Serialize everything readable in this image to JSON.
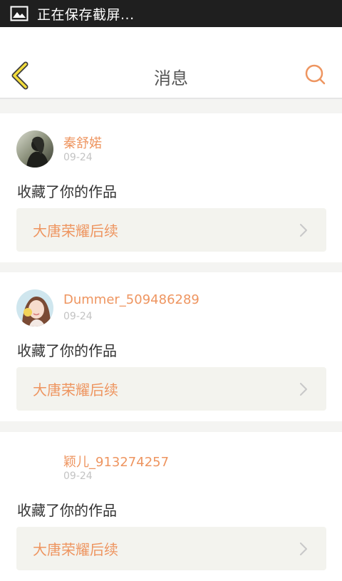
{
  "status_bar": {
    "icon": "image-icon",
    "text": "正在保存截屏..."
  },
  "header": {
    "title": "消息",
    "back_icon": "chevron-left-icon",
    "search_icon": "search-icon"
  },
  "colors": {
    "accent": "#ee9560",
    "back_icon": "#f3dc3c",
    "card_bg": "#ffffff",
    "page_bg": "#f4f4f2",
    "link_bg": "#f3f3ee"
  },
  "notifications": [
    {
      "username": "秦舒婼",
      "date": "09-24",
      "message": "收藏了你的作品",
      "work_title": "大唐荣耀后续",
      "avatar": "avatar-photo"
    },
    {
      "username": "Dummer_509486289",
      "date": "09-24",
      "message": "收藏了你的作品",
      "work_title": "大唐荣耀后续",
      "avatar": "avatar-photo"
    },
    {
      "username": "颖儿_913274257",
      "date": "09-24",
      "message": "收藏了你的作品",
      "work_title": "大唐荣耀后续",
      "avatar": "avatar-empty"
    }
  ]
}
